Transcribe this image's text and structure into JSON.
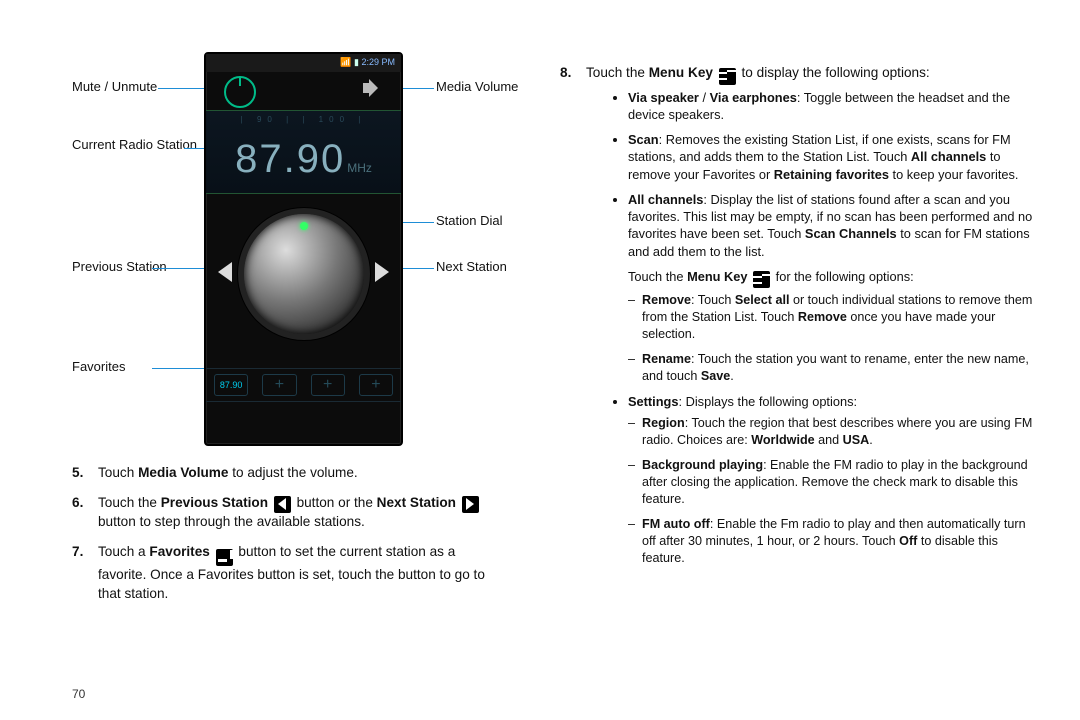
{
  "page_number": "70",
  "labels": {
    "mute": "Mute / Unmute",
    "media_volume": "Media Volume",
    "current_station": "Current Radio Station",
    "station_dial": "Station Dial",
    "prev_station": "Previous Station",
    "next_station": "Next Station",
    "favorites": "Favorites"
  },
  "phone": {
    "time": "2:29 PM",
    "ticks": "| 90 | | 100 |",
    "frequency": "87.90",
    "freq_unit": "MHz",
    "fav_slot1": "87.90",
    "fav_plus": "+"
  },
  "steps5": {
    "pre": "Touch ",
    "b1": "Media Volume",
    "post": " to adjust the volume."
  },
  "steps6": {
    "pre": "Touch the ",
    "b1": "Previous Station",
    "mid": " button or the ",
    "b2": "Next Station",
    "post": " button to step through the available stations."
  },
  "steps7": {
    "pre": "Touch a ",
    "b1": "Favorites",
    "post1": " button to set the current station as a favorite. Once a Favorites button is set, touch the button to go to that station."
  },
  "steps8": {
    "pre": "Touch the ",
    "b1": "Menu Key",
    "post": " to display the following options:"
  },
  "opt": {
    "via": {
      "b1": "Via speaker",
      "sep": " / ",
      "b2": "Via earphones",
      "t": ": Toggle between the headset and the device speakers."
    },
    "scan": {
      "b1": "Scan",
      "t1": ": Removes the existing Station List, if one exists, scans for FM stations, and adds them to the Station List. Touch ",
      "b2": "All channels",
      "t2": " to remove your Favorites or ",
      "b3": "Retaining favorites",
      "t3": " to keep your favorites."
    },
    "all": {
      "b1": "All channels",
      "t1": ": Display the list of stations found after a scan and you favorites. This list may be empty, if no scan has been performed and no favorites have been set. Touch ",
      "b2": "Scan Channels",
      "t2": " to scan for FM stations and add them to the list."
    },
    "intro2": {
      "pre": "Touch the ",
      "b1": "Menu Key",
      "post": " for the following options:"
    },
    "remove": {
      "b1": "Remove",
      "t1": ": Touch ",
      "b2": "Select all",
      "t2": " or touch individual stations to remove them from the Station List. Touch ",
      "b3": "Remove",
      "t3": " once you have made your selection."
    },
    "rename": {
      "b1": "Rename",
      "t1": ": Touch the station you want to rename, enter the new name, and touch ",
      "b2": "Save",
      "t2": "."
    },
    "settings": {
      "b1": "Settings",
      "t1": ": Displays the following options:"
    },
    "region": {
      "b1": "Region",
      "t1": ": Touch the region that best describes where you are using FM radio. Choices are: ",
      "b2": "Worldwide",
      "t2": " and ",
      "b3": "USA",
      "t3": "."
    },
    "bg": {
      "b1": "Background playing",
      "t1": ": Enable the FM radio to play in the background after closing the application. Remove the check mark to disable this feature."
    },
    "auto": {
      "b1": "FM auto off",
      "t1": ": Enable the Fm radio to play and then automatically turn off after 30 minutes, 1 hour, or 2 hours. Touch ",
      "b2": "Off",
      "t2": " to disable this feature."
    }
  }
}
